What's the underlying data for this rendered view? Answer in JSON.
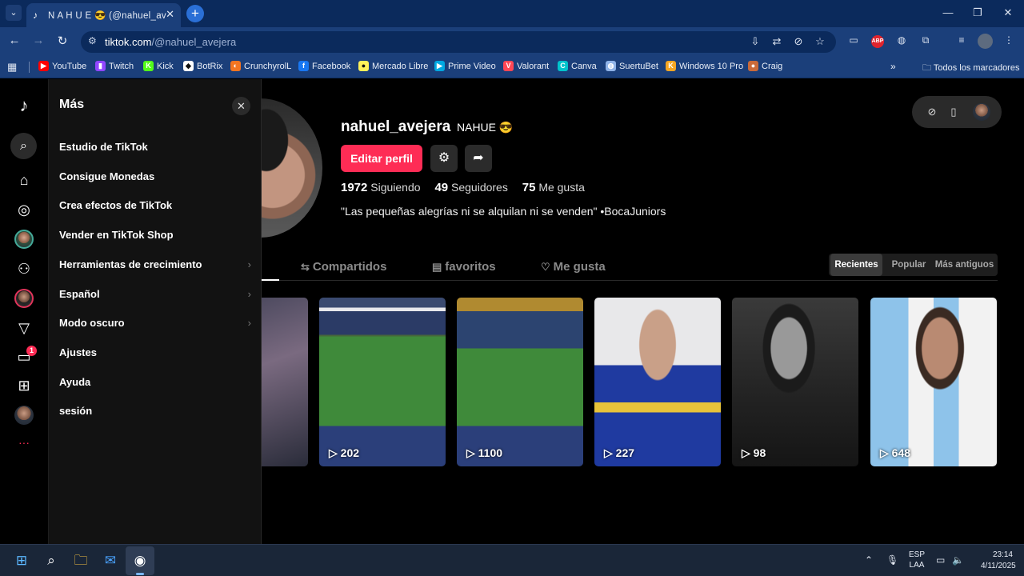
{
  "browser": {
    "tab_title": "N A H U E 😎 (@nahuel_avejera",
    "url_host": "tiktok.com",
    "url_path": "/@nahuel_avejera",
    "abp_label": "ABP",
    "bookmarks": [
      {
        "label": "YouTube",
        "icon": "youtube-icon",
        "color": "#ff0000"
      },
      {
        "label": "Twitch",
        "icon": "twitch-icon",
        "color": "#9146ff"
      },
      {
        "label": "Kick",
        "icon": "kick-icon",
        "color": "#53fc18"
      },
      {
        "label": "BotRix",
        "icon": "botrix-icon",
        "color": "#ffffff"
      },
      {
        "label": "CrunchyrolL",
        "icon": "crunchyroll-icon",
        "color": "#f47521"
      },
      {
        "label": "Facebook",
        "icon": "facebook-icon",
        "color": "#1877f2"
      },
      {
        "label": "Mercado Libre",
        "icon": "mercadolibre-icon",
        "color": "#fff159"
      },
      {
        "label": "Prime Video",
        "icon": "primevideo-icon",
        "color": "#00a8e1"
      },
      {
        "label": "Valorant",
        "icon": "valorant-icon",
        "color": "#ff4655"
      },
      {
        "label": "Canva",
        "icon": "canva-icon",
        "color": "#00c4cc"
      },
      {
        "label": "SuertuBet",
        "icon": "globe-icon",
        "color": "#8fb3e8"
      },
      {
        "label": "Windows 10 Pro",
        "icon": "windows-key-icon",
        "color": "#f5a623"
      },
      {
        "label": "Craig",
        "icon": "craig-icon",
        "color": "#c96a3a"
      }
    ],
    "all_bookmarks": "Todos los marcadores"
  },
  "more_panel": {
    "title": "Más",
    "items": [
      {
        "label": "Estudio de TikTok",
        "chevron": false
      },
      {
        "label": "Consigue Monedas",
        "chevron": false
      },
      {
        "label": "Crea efectos de TikTok",
        "chevron": false
      },
      {
        "label": "Vender en TikTok Shop",
        "chevron": false
      },
      {
        "label": "Herramientas de crecimiento",
        "chevron": true
      },
      {
        "label": "Español",
        "chevron": true
      },
      {
        "label": "Modo oscuro",
        "chevron": true
      },
      {
        "label": "Ajustes",
        "chevron": false
      },
      {
        "label": "Ayuda",
        "chevron": false
      },
      {
        "label": "sesión",
        "chevron": false
      }
    ]
  },
  "rail": {
    "messages_badge": "1"
  },
  "profile": {
    "username": "nahuel_avejera",
    "nickname": "NAHUE 😎",
    "edit_button": "Editar perfil",
    "following_count": "1972",
    "following_label": "Siguiendo",
    "followers_count": "49",
    "followers_label": "Seguidores",
    "likes_count": "75",
    "likes_label": "Me gusta",
    "bio": "\"Las pequeñas alegrías ni se alquilan ni se venden\" •BocaJuniors"
  },
  "tabs": [
    {
      "label": "Compartidos",
      "icon": "repost-icon"
    },
    {
      "label": "favoritos",
      "icon": "bookmark-icon"
    },
    {
      "label": "Me gusta",
      "icon": "heart-icon"
    }
  ],
  "sort": {
    "options": [
      "Recientes",
      "Popular",
      "Más antiguos"
    ],
    "active": "Recientes"
  },
  "videos": [
    {
      "views": ""
    },
    {
      "views": "202"
    },
    {
      "views": "1100"
    },
    {
      "views": "227"
    },
    {
      "views": "98"
    },
    {
      "views": "648"
    }
  ],
  "taskbar": {
    "lang_top": "ESP",
    "lang_bottom": "LAA",
    "time": "23:14",
    "date": "4/11/2025"
  }
}
